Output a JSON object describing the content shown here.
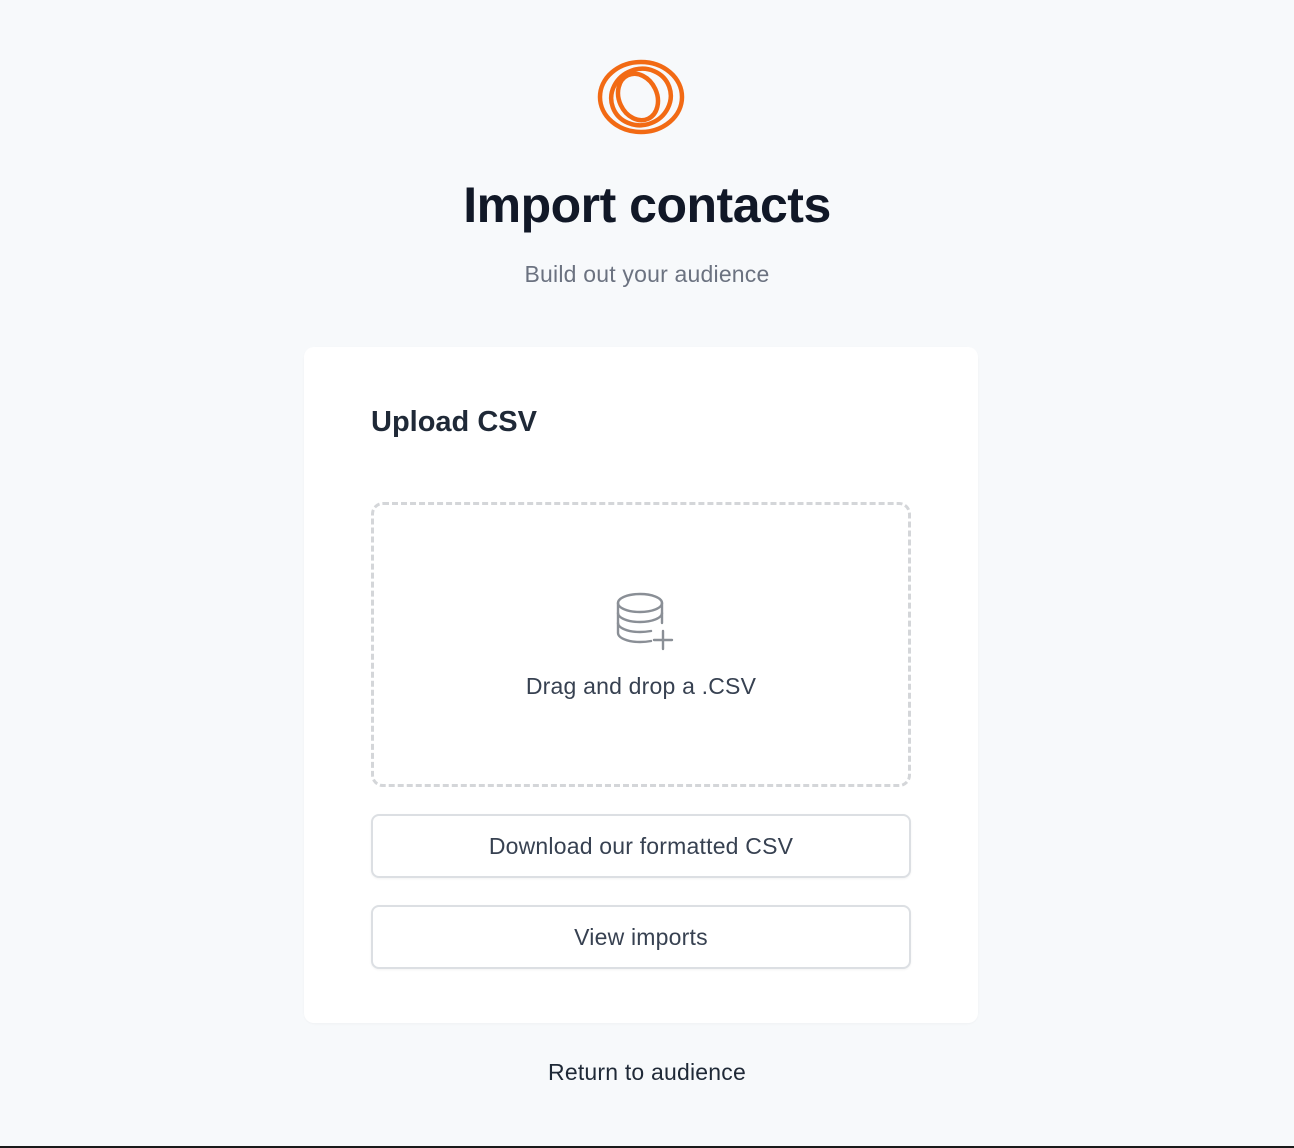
{
  "brand": {
    "logo_icon": "orange-rings-logo-icon",
    "accent_color": "#f26a14"
  },
  "header": {
    "title": "Import contacts",
    "subtitle": "Build out your audience"
  },
  "upload_card": {
    "title": "Upload CSV",
    "dropzone": {
      "icon": "database-add-icon",
      "label": "Drag and drop a .CSV"
    },
    "download_button_label": "Download our formatted CSV",
    "view_imports_button_label": "View imports"
  },
  "footer": {
    "return_link_label": "Return to audience"
  }
}
